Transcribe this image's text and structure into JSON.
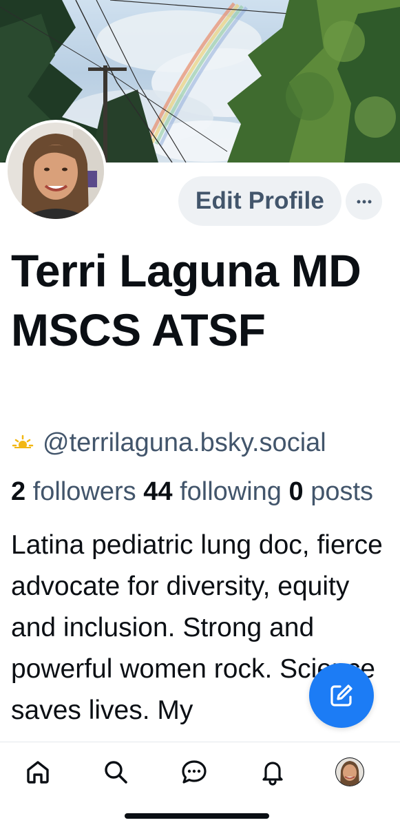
{
  "profile": {
    "display_name": "Terri Laguna MD MSCS ATSF",
    "handle": "@terrilaguna.bsky.social",
    "handle_emoji": "sun-emoji-icon",
    "followers_count": "2",
    "followers_label": "followers",
    "following_count": "44",
    "following_label": "following",
    "posts_count": "0",
    "posts_label": "posts",
    "bio": "Latina pediatric lung doc, fierce advocate for diversity, equity and inclusion. Strong and powerful women rock. Science saves lives. My"
  },
  "actions": {
    "edit_profile_label": "Edit Profile",
    "more_icon": "ellipsis-icon",
    "compose_icon": "compose-icon"
  },
  "nav": {
    "items": [
      "home-icon",
      "search-icon",
      "chat-icon",
      "bell-icon",
      "profile-avatar"
    ]
  },
  "colors": {
    "accent": "#1c7cf5",
    "muted_text": "#42556b",
    "button_bg": "#eef1f4",
    "text": "#0b0f14"
  }
}
